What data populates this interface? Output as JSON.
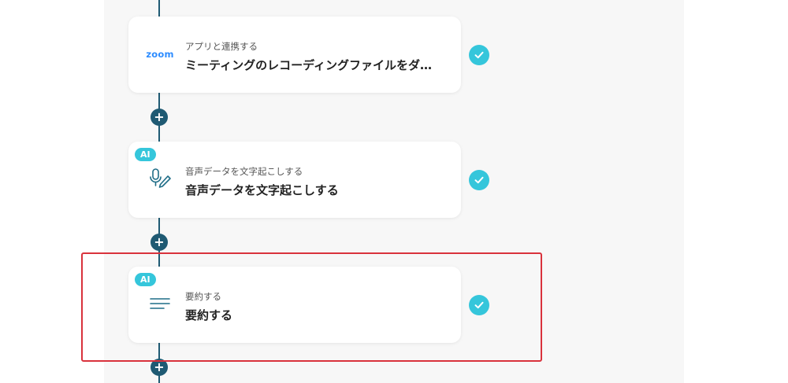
{
  "steps": [
    {
      "app_logo": "zoom",
      "icon": "zoom-logo",
      "subtitle": "アプリと連携する",
      "title": "ミーティングのレコーディングファイルをダ…",
      "status": "completed"
    },
    {
      "badge": "AI",
      "icon": "microphone-pen-icon",
      "subtitle": "音声データを文字起こしする",
      "title": "音声データを文字起こしする",
      "status": "completed"
    },
    {
      "badge": "AI",
      "icon": "text-lines-icon",
      "subtitle": "要約する",
      "title": "要約する",
      "status": "completed"
    }
  ],
  "add_button_symbol": "+",
  "colors": {
    "flow_line": "#1f5a73",
    "accent": "#35c6db",
    "zoom_brand": "#2d8cff",
    "highlight": "#d9323c"
  }
}
